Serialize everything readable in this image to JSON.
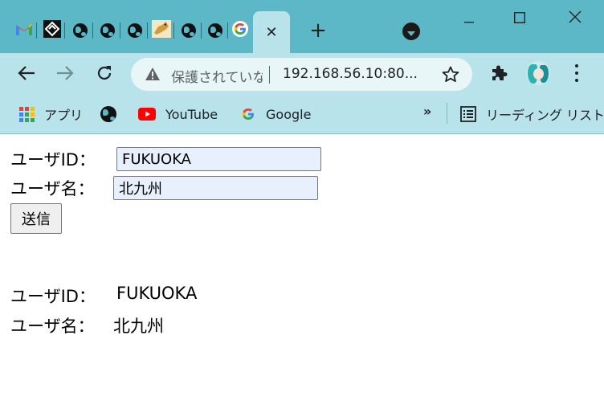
{
  "tabs": {
    "favicons": [
      "gmail-icon",
      "app-icon",
      "globe-icon",
      "globe-icon",
      "globe-icon",
      "tomcat-icon",
      "globe-icon",
      "globe-icon",
      "google-icon"
    ],
    "active_close": "✕",
    "new_tab": "+"
  },
  "toolbar": {
    "security_status": "保護されていない通信",
    "url": "192.168.56.10:80..."
  },
  "bookmarks": {
    "apps_label": "アプリ",
    "youtube_label": "YouTube",
    "google_label": "Google",
    "more": "»",
    "reading_list_label": "リーディング リスト"
  },
  "form": {
    "user_id_label": "ユーザID：",
    "user_id_value": "FUKUOKA",
    "user_name_label": "ユーザ名：",
    "user_name_value": "北九州",
    "submit_label": "送信"
  },
  "result": {
    "user_id_label": "ユーザID：",
    "user_id_value": "FUKUOKA",
    "user_name_label": "ユーザ名：",
    "user_name_value": "北九州"
  },
  "colors": {
    "titlebar": "#5cb8c6",
    "toolbar": "#b8e3ea",
    "autofill": "#e8f0fe"
  }
}
